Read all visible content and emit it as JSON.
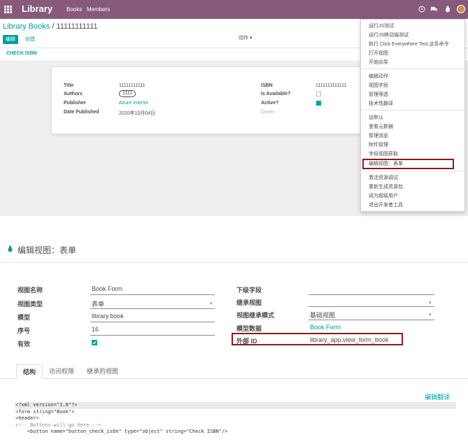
{
  "topbar": {
    "brand": "Library",
    "menu": [
      "Books",
      "Members"
    ],
    "icons": [
      "clock-icon",
      "chat-icon",
      "bug-icon",
      "user-avatar"
    ]
  },
  "breadcrumb": {
    "root": "Library Books",
    "separator": "/",
    "current": "11111111111"
  },
  "control_panel": {
    "edit_label": "编辑",
    "create_label": "创建",
    "action_label": "动作 ▾"
  },
  "statusbar": {
    "check_isbn_label": "CHECK ISBN"
  },
  "form": {
    "title_label": "Title",
    "title_value": "11111111111",
    "authors_label": "Authors",
    "authors_value": "1111",
    "publisher_label": "Publisher",
    "publisher_value": "Azure Interior",
    "date_label": "Date Published",
    "date_value": "2020年10月04日",
    "isbn_label": "ISBN",
    "isbn_value": "1111111111111",
    "available_label": "Is Available?",
    "active_label": "Active?",
    "cover_label": "Cover"
  },
  "debug_menu": {
    "group1": [
      "运行JS测试",
      "运行JS移动端测试",
      "执行 Click Everywhere Test 这条命令",
      "打开视图",
      "开始向导"
    ],
    "group2": [
      "编辑动作",
      "视图字段",
      "管理筛选",
      "技术性翻译"
    ],
    "group3": [
      "设默认",
      "查看元数据",
      "管理消息",
      "附件管理",
      "字段视图获取",
      "编辑视图：表单"
    ],
    "group4": [
      "激活资源调试",
      "重新生成资源包",
      "成为超级用户",
      "退出开发者工具"
    ]
  },
  "edit_view": {
    "title": "编辑视图：表单",
    "view_name_label": "视图名称",
    "view_name_value": "Book Form",
    "view_type_label": "视图类型",
    "view_type_value": "表单",
    "model_label": "模型",
    "model_value": "library.book",
    "sequence_label": "序号",
    "sequence_value": "16",
    "active_label": "有效",
    "child_field_label": "下级字段",
    "inherit_view_label": "继承视图",
    "inherit_mode_label": "视图继承模式",
    "inherit_mode_value": "基础视图",
    "model_data_label": "模型数据",
    "model_data_value": "Book Form",
    "external_id_label": "外部 ID",
    "external_id_value": "library_app.view_form_book",
    "tabs": [
      "结构",
      "访问权限",
      "继承的视图"
    ],
    "edit_translation": "编辑翻译"
  },
  "code": {
    "line1": "<?xml version=\"1.0\"?>",
    "line2": "<form string=\"Book\">",
    "line3": "<header>",
    "line4": "<!-- Buttons will go here -->",
    "line5": "    <button name=\"button_check_isbn\" type=\"object\" string=\"Check ISBN\"/>"
  }
}
